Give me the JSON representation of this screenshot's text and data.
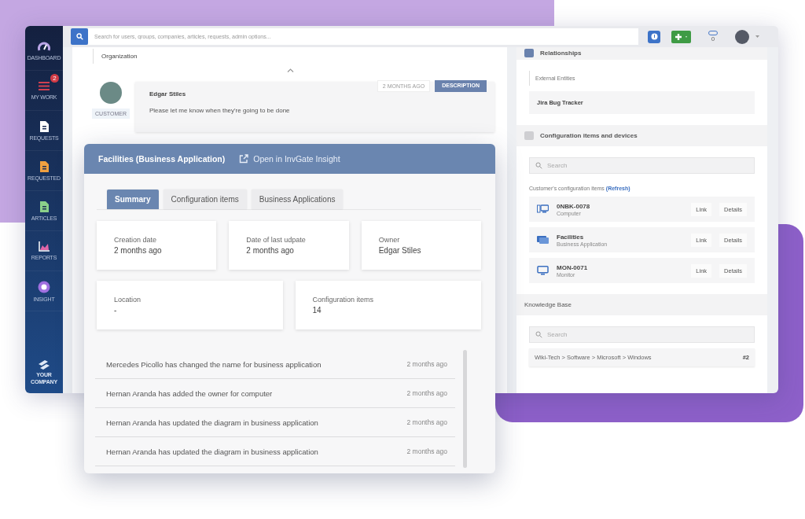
{
  "sidebar": {
    "items": [
      {
        "label": "DASHBOARD"
      },
      {
        "label": "MY WORK",
        "badge": "2"
      },
      {
        "label": "REQUESTS"
      },
      {
        "label": "REQUESTED"
      },
      {
        "label": "ARTICLES"
      },
      {
        "label": "REPORTS"
      },
      {
        "label": "INSIGHT"
      }
    ],
    "logo_text": "YOUR COMPANY"
  },
  "top_bar": {
    "search": {
      "placeholder": "Search for users, groups, companies, articles, requests, admin options..."
    },
    "notifications_count": "0"
  },
  "request": {
    "section_label": "Organization",
    "comment": {
      "author": "Edgar Stiles",
      "role": "CUSTOMER",
      "text": "Please let me know when they're going to be done",
      "time": "2 MONTHS AGO",
      "tag": "DESCRIPTION"
    }
  },
  "item_card": {
    "title": "Facilities (Business Application)",
    "link": "Open in InvGate Insight",
    "tabs": [
      {
        "label": "Summary",
        "selected": true
      },
      {
        "label": "Configuration items",
        "selected": false
      },
      {
        "label": "Business Applications",
        "selected": false
      }
    ],
    "field_rows": [
      [
        {
          "label": "Creation date",
          "value": "2 months ago"
        },
        {
          "label": "Date of last udpate",
          "value": "2 months ago"
        },
        {
          "label": "Owner",
          "value": "Edgar Stiles"
        }
      ],
      [
        {
          "label": "Location",
          "value": "-"
        },
        {
          "label": "Configuration items",
          "value": "14"
        }
      ]
    ],
    "activity": [
      {
        "text": "Mercedes Picollo has changed the name for business application",
        "time": "2 months ago"
      },
      {
        "text": "Hernan Aranda has added the owner for computer",
        "time": "2 months ago"
      },
      {
        "text": "Hernan Aranda has updated the diagram in business application",
        "time": "2 months ago"
      },
      {
        "text": "Hernan Aranda has updated the diagram in business application",
        "time": "2 months ago"
      }
    ]
  },
  "side_panel": {
    "relationships": {
      "title": "Relationships",
      "label": "External Entities",
      "entity": "Jira Bug Tracker"
    },
    "configuration": {
      "title": "Configuration items and devices",
      "search_placeholder": "Search",
      "label": "Customer's configuration items",
      "refresh": "(Refresh)",
      "items": [
        {
          "kind": "computer",
          "name": "0NBK-0078",
          "type": "Computer",
          "link": "Link",
          "details": "Details"
        },
        {
          "kind": "application",
          "name": "Facilities",
          "type": "Business Application",
          "link": "Link",
          "details": "Details"
        },
        {
          "kind": "monitor",
          "name": "MON-0071",
          "type": "Monitor",
          "link": "Link",
          "details": "Details"
        }
      ]
    },
    "knowledge_base": {
      "title": "Knowledge Base",
      "search_placeholder": "Search",
      "articles": [
        {
          "path": "Wiki-Tech > Software > Microsoft > Windows",
          "count": "#2"
        }
      ]
    }
  }
}
